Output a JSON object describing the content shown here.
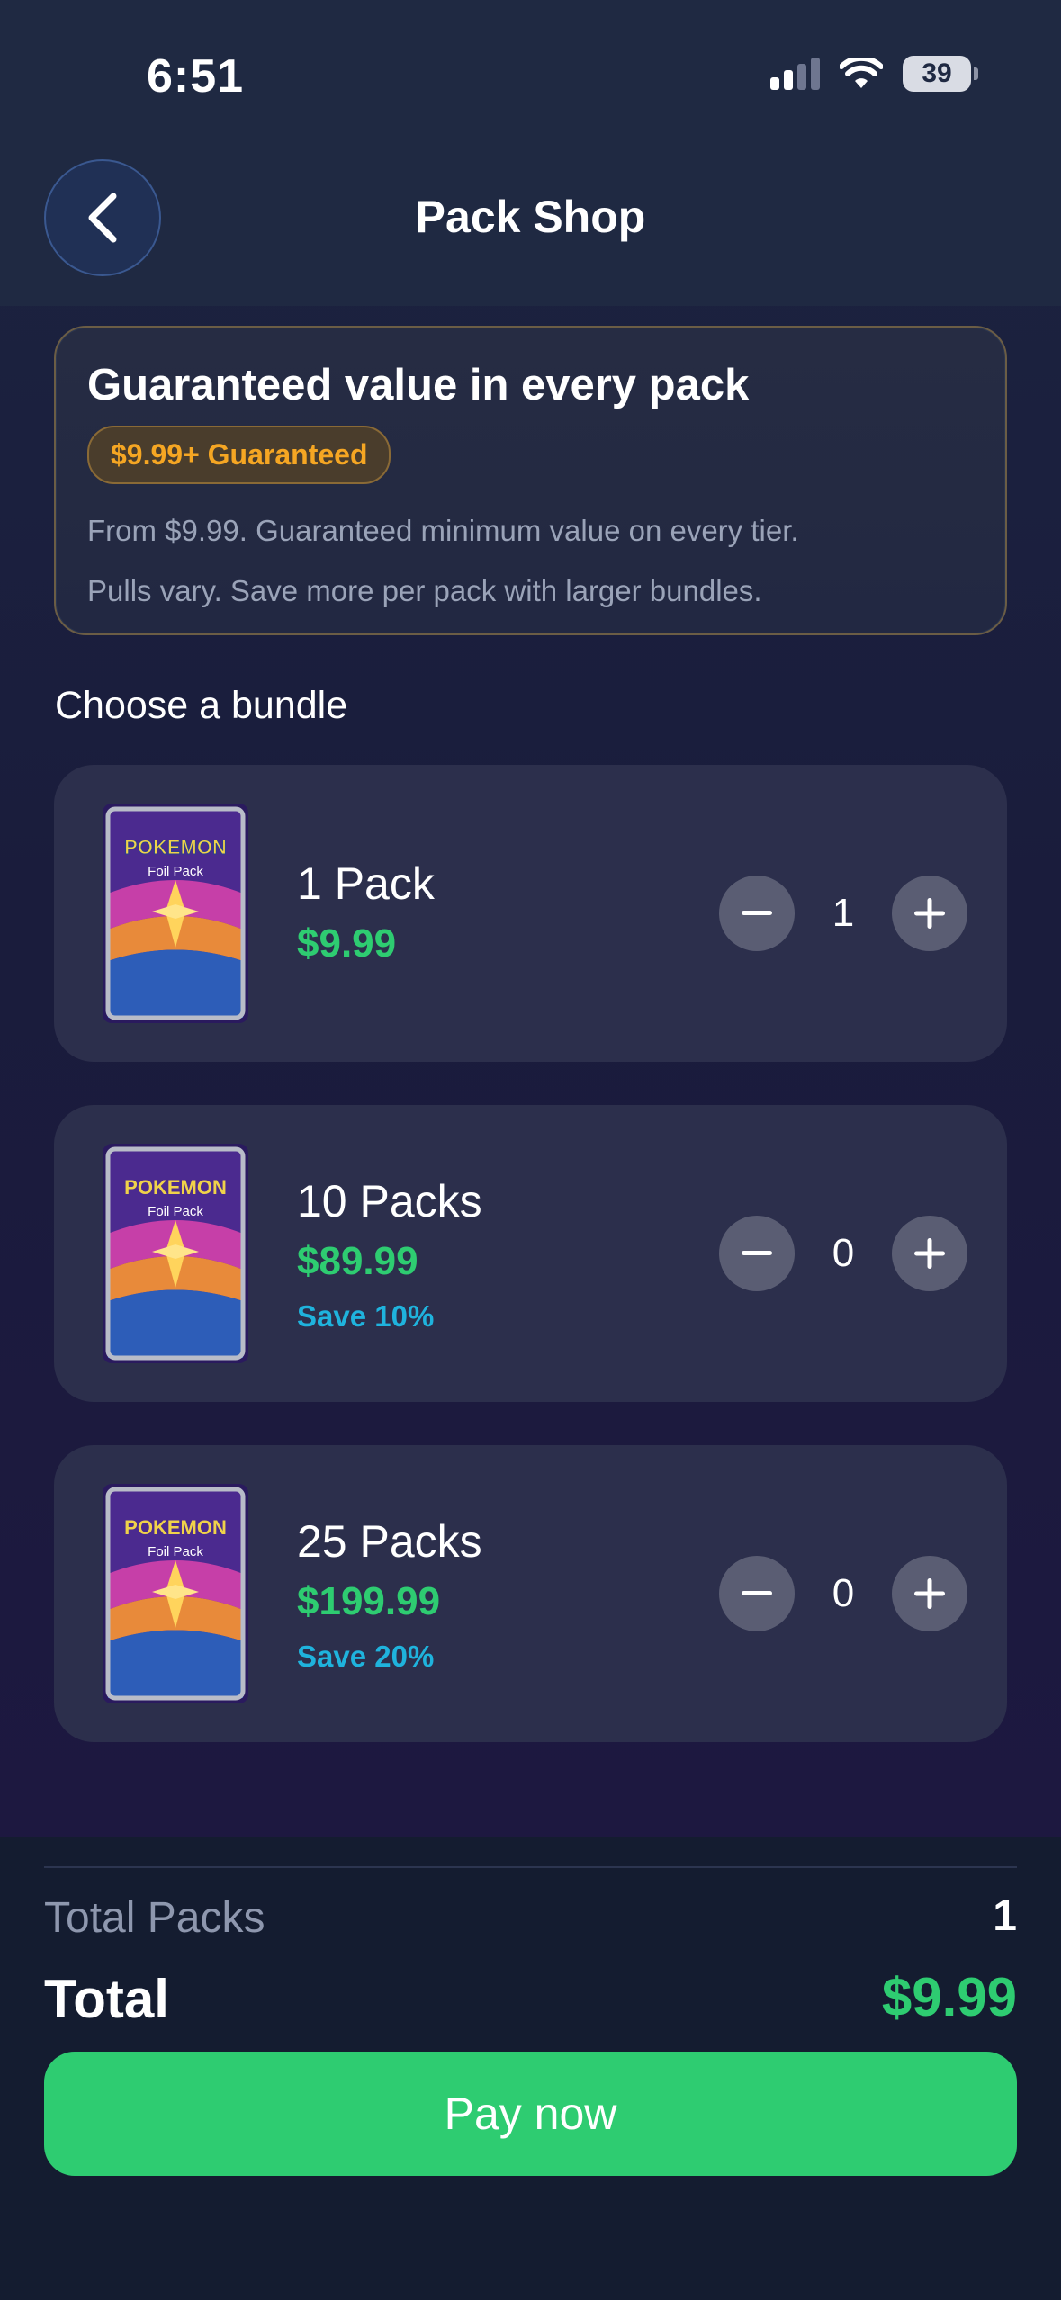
{
  "status_bar": {
    "time": "6:51",
    "battery": "39"
  },
  "header": {
    "title": "Pack Shop",
    "back_icon": "chevron-left-icon"
  },
  "guarantee": {
    "heading": "Guaranteed value in every pack",
    "badge": "$9.99+ Guaranteed",
    "line1": "From $9.99. Guaranteed minimum value on every tier.",
    "line2": "Pulls vary. Save more per pack with larger bundles."
  },
  "section_label": "Choose a bundle",
  "bundles": [
    {
      "title": "1 Pack",
      "price": "$9.99",
      "save": "",
      "count": "1"
    },
    {
      "title": "10 Packs",
      "price": "$89.99",
      "save": "Save 10%",
      "count": "0"
    },
    {
      "title": "25 Packs",
      "price": "$199.99",
      "save": "Save 20%",
      "count": "0"
    }
  ],
  "pack_art": {
    "brand": "POKEMON",
    "sub": "Foil Pack"
  },
  "summary": {
    "total_packs_label": "Total Packs",
    "total_packs_value": "1",
    "total_label": "Total",
    "total_value": "$9.99"
  },
  "pay_button": "Pay now",
  "colors": {
    "accent_green": "#2ecc71",
    "badge_orange": "#f5a623",
    "save_blue": "#1fb3dd"
  }
}
